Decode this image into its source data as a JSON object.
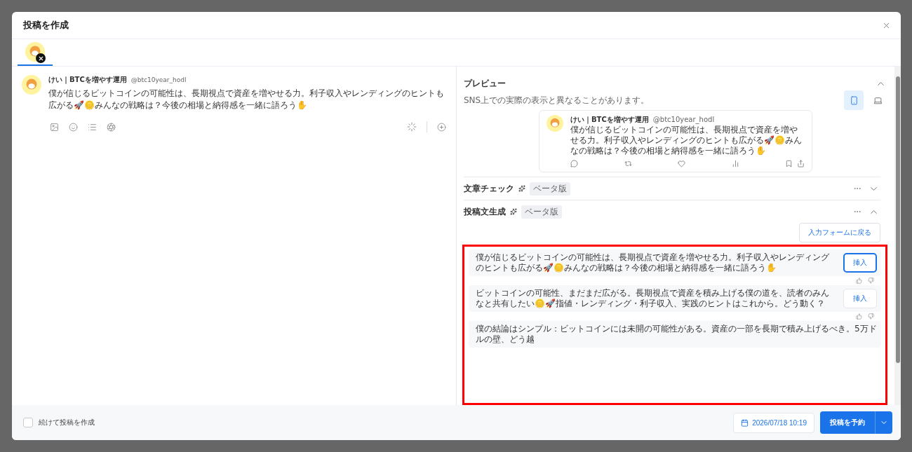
{
  "dialog": {
    "title": "投稿を作成"
  },
  "account_tabs": [
    {
      "selected": true
    }
  ],
  "editor": {
    "display_name": "けい｜BTCを増やす運用",
    "handle": "@btc10year_hodl",
    "text": "僕が信じるビットコインの可能性は、長期視点で資産を増やせる力。利子収入やレンディングのヒントも広がる🚀🪙みんなの戦略は？今後の相場と納得感を一緒に語ろう✋"
  },
  "preview": {
    "title": "プレビュー",
    "expanded": true,
    "note": "SNS上での実際の表示と異なることがあります。",
    "devices": [
      {
        "kind": "mobile",
        "selected": true
      },
      {
        "kind": "desktop",
        "selected": false
      }
    ],
    "post": {
      "display_name": "けい｜BTCを増やす運用",
      "handle": "@btc10year_hodl",
      "text": "僕が信じるビットコインの可能性は、長期視点で資産を増やせる力。利子収入やレンディングのヒントも広がる🚀🪙みんなの戦略は？今後の相場と納得感を一緒に語ろう✋"
    }
  },
  "sections": [
    {
      "title": "文章チェック",
      "badge": "ベータ版",
      "expanded": false
    },
    {
      "title": "投稿文生成",
      "badge": "ベータ版",
      "expanded": true
    }
  ],
  "generator": {
    "back_button": "入力フォームに戻る",
    "suggestions": [
      {
        "text": "僕が信じるビットコインの可能性は、長期視点で資産を増やせる力。利子収入やレンディングのヒントも広がる🚀🪙みんなの戦略は？今後の相場と納得感を一緒に語ろう✋",
        "button": "挿入",
        "focused": true
      },
      {
        "text": "ビットコインの可能性、まだまだ広がる。長期視点で資産を積み上げる僕の道を、読者のみんなと共有したい🪙🚀指値・レンディング・利子収入、実践のヒントはこれから。どう動く？",
        "button": "挿入",
        "focused": false
      },
      {
        "text": "僕の結論はシンプル：ビットコインには未開の可能性がある。資産の一部を長期で積み上げるべき。5万ドルの壁、どう越"
      }
    ]
  },
  "footer": {
    "continue_label": "続けて投稿を作成",
    "continue_checked": false,
    "datetime": "2026/07/18 10:19",
    "schedule_button": "投稿を予約"
  }
}
